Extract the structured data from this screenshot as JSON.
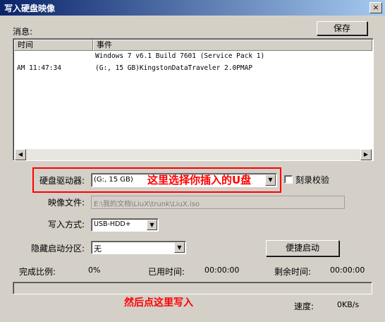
{
  "window": {
    "title": "写入硬盘映像",
    "close_glyph": "×"
  },
  "messages": {
    "label": "消息:",
    "save_button": "保存",
    "columns": [
      "时间",
      "事件"
    ],
    "rows": [
      {
        "time": "",
        "event": "Windows 7 v6.1 Build 7601 (Service Pack 1)"
      },
      {
        "time": "AM 11:47:34",
        "event": "(G:, 15 GB)KingstonDataTraveler 2.0PMAP"
      }
    ]
  },
  "drive": {
    "label": "硬盘驱动器:",
    "value": "(G:, 15 GB)",
    "annotation": "这里选择你插入的U盘"
  },
  "verify": {
    "label": "刻录校验",
    "checked": false
  },
  "image_file": {
    "label": "映像文件:",
    "value": "E:\\我的文档\\LiuX\\trunk\\LiuX.iso"
  },
  "write_method": {
    "label": "写入方式:",
    "value": "USB-HDD+"
  },
  "hidden_partition": {
    "label": "隐藏启动分区:",
    "value": "无"
  },
  "quick_boot_button": "便捷启动",
  "status": {
    "progress_label": "完成比例:",
    "progress_value": "0%",
    "elapsed_label": "已用时间:",
    "elapsed_value": "00:00:00",
    "remaining_label": "剩余时间:",
    "remaining_value": "00:00:00",
    "speed_label": "速度:",
    "speed_value": "0KB/s",
    "progress_fraction": 0
  },
  "bottom_annotation": "然后点这里写入",
  "icons": {
    "scroll_left": "left-arrow-icon",
    "scroll_right": "right-arrow-icon",
    "dropdown": "chevron-down-icon"
  },
  "colors": {
    "annotation": "#ff0000",
    "titlebar": "#0a246a"
  }
}
